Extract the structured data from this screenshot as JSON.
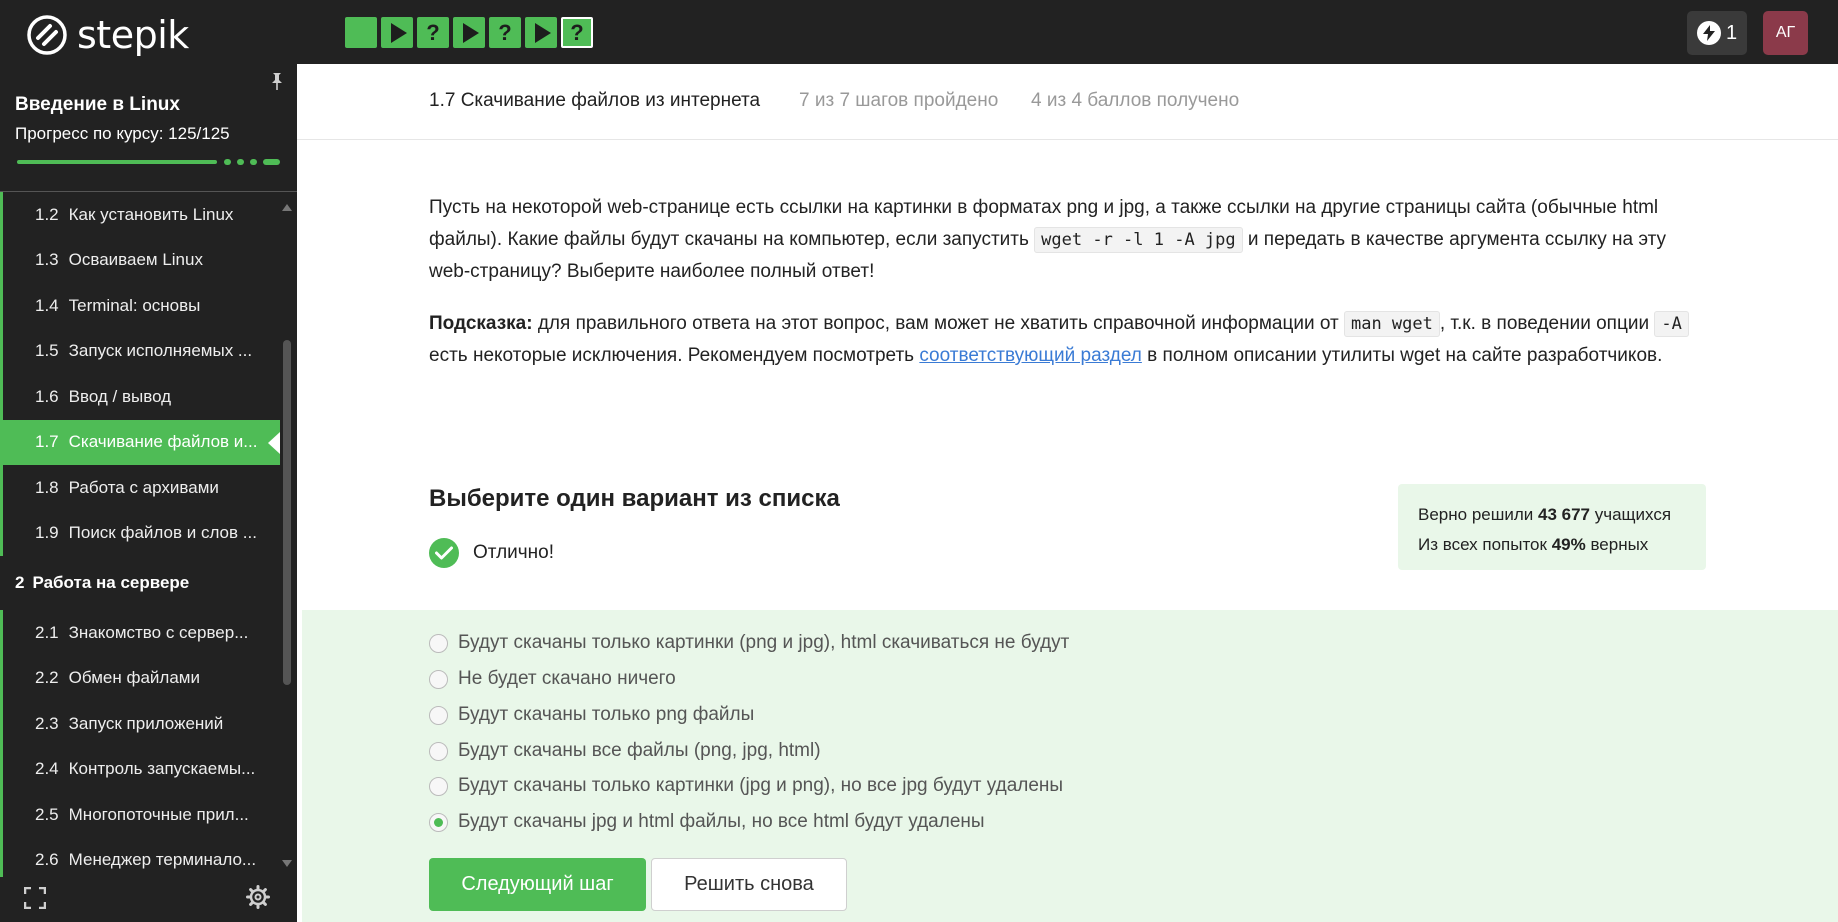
{
  "app": {
    "logo_text": "stepik"
  },
  "steps": [
    {
      "type": "done",
      "icon": "square-icon"
    },
    {
      "type": "play",
      "icon": "play-icon"
    },
    {
      "type": "quiz",
      "label": "?"
    },
    {
      "type": "play",
      "icon": "play-icon"
    },
    {
      "type": "quiz",
      "label": "?"
    },
    {
      "type": "play",
      "icon": "play-icon"
    },
    {
      "type": "quiz-active",
      "label": "?"
    }
  ],
  "header": {
    "energy_count": "1",
    "avatar_initials": "АГ"
  },
  "sidebar": {
    "course_title": "Введение в Linux",
    "progress_label": "Прогресс по курсу:  125/125",
    "progress": {
      "current": 125,
      "total": 125
    },
    "items": [
      {
        "num": "1.2",
        "label": "Как установить Linux"
      },
      {
        "num": "1.3",
        "label": "Осваиваем Linux"
      },
      {
        "num": "1.4",
        "label": "Terminal: основы"
      },
      {
        "num": "1.5",
        "label": "Запуск исполняемых ..."
      },
      {
        "num": "1.6",
        "label": "Ввод / вывод"
      },
      {
        "num": "1.7",
        "label": "Скачивание файлов и..."
      },
      {
        "num": "1.8",
        "label": "Работа с архивами"
      },
      {
        "num": "1.9",
        "label": "Поиск файлов и слов ..."
      }
    ],
    "section": {
      "num": "2",
      "label": "Работа на сервере"
    },
    "items2": [
      {
        "num": "2.1",
        "label": "Знакомство с сервер..."
      },
      {
        "num": "2.2",
        "label": "Обмен файлами"
      },
      {
        "num": "2.3",
        "label": "Запуск приложений"
      },
      {
        "num": "2.4",
        "label": "Контроль запускаемы..."
      },
      {
        "num": "2.5",
        "label": "Многопоточные прил..."
      },
      {
        "num": "2.6",
        "label": "Менеджер терминало..."
      }
    ]
  },
  "lesson": {
    "title": "1.7 Скачивание файлов из интернета",
    "steps_done": "7 из 7 шагов пройдено",
    "score": "4 из 4 баллов  получено"
  },
  "question": {
    "p1_a": "Пусть на некоторой web-странице есть ссылки на картинки в форматах png и jpg, а также ссылки на другие страницы сайта (обычные html файлы). Какие файлы будут скачаны на компьютер, если запустить ",
    "p1_code": "wget -r -l 1 -A jpg",
    "p1_b": " и передать в качестве аргумента ссылку на эту web-страницу? Выберите наиболее полный ответ!",
    "hint_label": "Подсказка:",
    "p2_a": " для правильного ответа на этот вопрос, вам может не хватить справочной информации от ",
    "p2_code1": "man wget",
    "p2_b": ", т.к. в поведении опции ",
    "p2_code2": "-A",
    "p2_c": " есть некоторые исключения. Рекомендуем посмотреть ",
    "p2_link": "соответствующий раздел",
    "p2_d": " в полном описании утилиты wget на сайте разработчиков."
  },
  "quiz": {
    "title": "Выберите один вариант из списка",
    "status": "Отлично!",
    "stats_line1_a": "Верно решили ",
    "stats_line1_b": "43 677",
    "stats_line1_c": " учащихся",
    "stats_line2_a": "Из всех попыток ",
    "stats_line2_b": "49%",
    "stats_line2_c": " верных",
    "options": [
      {
        "label": "Будут скачаны только картинки (png и jpg), html скачиваться не будут",
        "checked": false
      },
      {
        "label": "Не будет скачано ничего",
        "checked": false
      },
      {
        "label": "Будут скачаны только png файлы",
        "checked": false
      },
      {
        "label": "Будут скачаны все файлы (png, jpg, html)",
        "checked": false
      },
      {
        "label": "Будут скачаны только картинки (jpg и png), но все jpg будут удалены",
        "checked": false
      },
      {
        "label": "Будут скачаны jpg и html файлы, но все html будут удалены",
        "checked": true
      }
    ],
    "next_button": "Следующий шаг",
    "retry_button": "Решить снова"
  },
  "colors": {
    "accent": "#4fbc56",
    "dark": "#222222",
    "answer_bg": "#e9f7e9",
    "link": "#3a7bd5"
  }
}
